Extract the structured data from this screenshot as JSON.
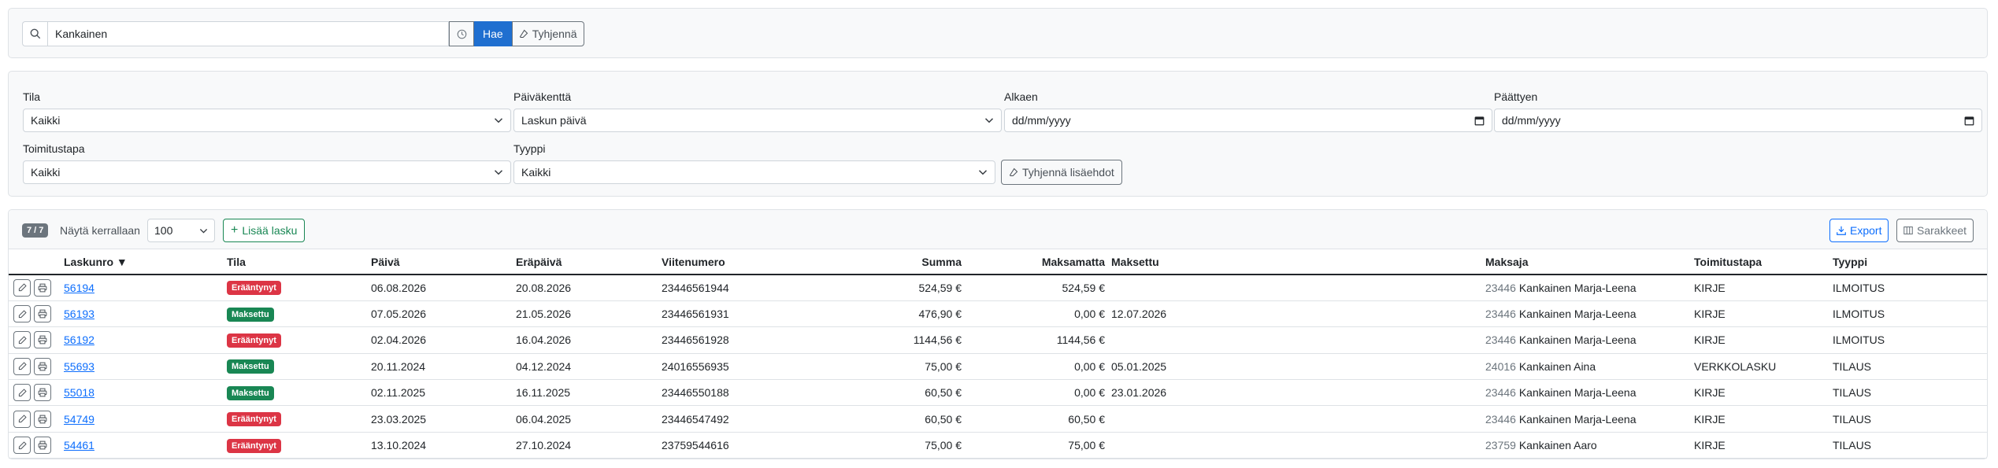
{
  "search": {
    "value": "Kankainen",
    "search_button": "Hae",
    "clear_button": "Tyhjennä"
  },
  "filters": {
    "tila": {
      "label": "Tila",
      "value": "Kaikki"
    },
    "paivakentta": {
      "label": "Päiväkenttä",
      "value": "Laskun päivä"
    },
    "alkaen": {
      "label": "Alkaen",
      "placeholder": "dd/mm/yyyy"
    },
    "paattyen": {
      "label": "Päättyen",
      "placeholder": "dd/mm/yyyy"
    },
    "toimitustapa": {
      "label": "Toimitustapa",
      "value": "Kaikki"
    },
    "tyyppi": {
      "label": "Tyyppi",
      "value": "Kaikki"
    },
    "clear_button": "Tyhjennä lisäehdot"
  },
  "toolbar": {
    "count": "7 / 7",
    "per_page_label": "Näytä kerrallaan",
    "per_page_value": "100",
    "add_button": "Lisää lasku",
    "export_button": "Export",
    "columns_button": "Sarakkeet"
  },
  "table": {
    "headers": {
      "laskunro": "Laskunro ▼",
      "tila": "Tila",
      "paiva": "Päivä",
      "erapaiva": "Eräpäivä",
      "viitenumero": "Viitenumero",
      "summa": "Summa",
      "maksamatta": "Maksamatta",
      "maksettu": "Maksettu",
      "maksaja": "Maksaja",
      "toimitustapa": "Toimitustapa",
      "tyyppi": "Tyyppi"
    },
    "rows": [
      {
        "laskunro": "56194",
        "tila": "Erääntynyt",
        "paiva": "06.08.2026",
        "erapaiva": "20.08.2026",
        "viitenumero": "23446561944",
        "summa": "524,59 €",
        "maksamatta": "524,59 €",
        "maksettu": "",
        "maksaja_id": "23446",
        "maksaja_nimi": "Kankainen Marja-Leena",
        "toimitustapa": "KIRJE",
        "tyyppi": "ILMOITUS"
      },
      {
        "laskunro": "56193",
        "tila": "Maksettu",
        "paiva": "07.05.2026",
        "erapaiva": "21.05.2026",
        "viitenumero": "23446561931",
        "summa": "476,90 €",
        "maksamatta": "0,00 €",
        "maksettu": "12.07.2026",
        "maksaja_id": "23446",
        "maksaja_nimi": "Kankainen Marja-Leena",
        "toimitustapa": "KIRJE",
        "tyyppi": "ILMOITUS"
      },
      {
        "laskunro": "56192",
        "tila": "Erääntynyt",
        "paiva": "02.04.2026",
        "erapaiva": "16.04.2026",
        "viitenumero": "23446561928",
        "summa": "1144,56 €",
        "maksamatta": "1144,56 €",
        "maksettu": "",
        "maksaja_id": "23446",
        "maksaja_nimi": "Kankainen Marja-Leena",
        "toimitustapa": "KIRJE",
        "tyyppi": "ILMOITUS"
      },
      {
        "laskunro": "55693",
        "tila": "Maksettu",
        "paiva": "20.11.2024",
        "erapaiva": "04.12.2024",
        "viitenumero": "24016556935",
        "summa": "75,00 €",
        "maksamatta": "0,00 €",
        "maksettu": "05.01.2025",
        "maksaja_id": "24016",
        "maksaja_nimi": "Kankainen Aina",
        "toimitustapa": "VERKKOLASKU",
        "tyyppi": "TILAUS"
      },
      {
        "laskunro": "55018",
        "tila": "Maksettu",
        "paiva": "02.11.2025",
        "erapaiva": "16.11.2025",
        "viitenumero": "23446550188",
        "summa": "60,50 €",
        "maksamatta": "0,00 €",
        "maksettu": "23.01.2026",
        "maksaja_id": "23446",
        "maksaja_nimi": "Kankainen Marja-Leena",
        "toimitustapa": "KIRJE",
        "tyyppi": "TILAUS"
      },
      {
        "laskunro": "54749",
        "tila": "Erääntynyt",
        "paiva": "23.03.2025",
        "erapaiva": "06.04.2025",
        "viitenumero": "23446547492",
        "summa": "60,50 €",
        "maksamatta": "60,50 €",
        "maksettu": "",
        "maksaja_id": "23446",
        "maksaja_nimi": "Kankainen Marja-Leena",
        "toimitustapa": "KIRJE",
        "tyyppi": "TILAUS"
      },
      {
        "laskunro": "54461",
        "tila": "Erääntynyt",
        "paiva": "13.10.2024",
        "erapaiva": "27.10.2024",
        "viitenumero": "23759544616",
        "summa": "75,00 €",
        "maksamatta": "75,00 €",
        "maksettu": "",
        "maksaja_id": "23759",
        "maksaja_nimi": "Kankainen Aaro",
        "toimitustapa": "KIRJE",
        "tyyppi": "TILAUS"
      }
    ]
  },
  "status_colors": {
    "Erääntynyt": "#dc3545",
    "Maksettu": "#198754"
  }
}
